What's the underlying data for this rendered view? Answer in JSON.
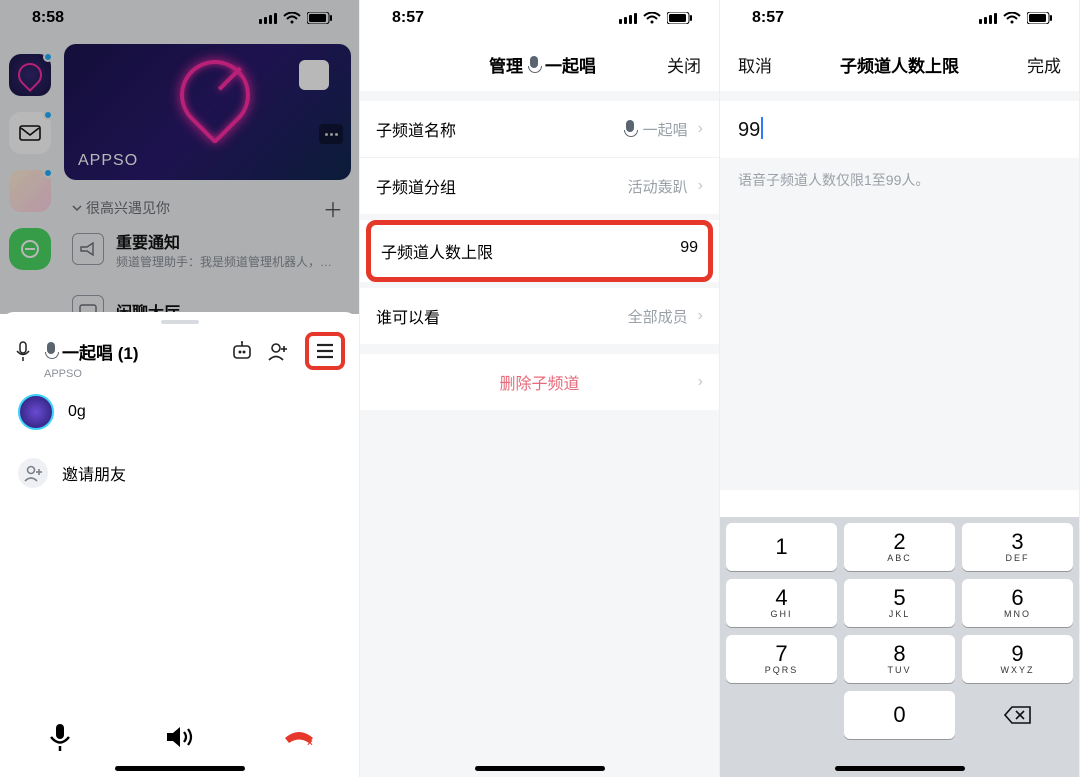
{
  "phone1": {
    "status_time": "8:58",
    "hero_label": "APPSO",
    "list_header": "很高兴遇见你",
    "item1_title": "重要通知",
    "item1_sub": "频道管理助手：我是频道管理机器人，…",
    "item2_title": "闲聊大厅",
    "sheet_title": "一起唱 (1)",
    "sheet_sub": "APPSO",
    "member_name": "0g",
    "invite_label": "邀请朋友"
  },
  "phone2": {
    "status_time": "8:57",
    "nav_prefix": "管理",
    "nav_suffix": "一起唱",
    "nav_close": "关闭",
    "row_name_label": "子频道名称",
    "row_name_value": "一起唱",
    "row_group_label": "子频道分组",
    "row_group_value": "活动轰趴",
    "row_limit_label": "子频道人数上限",
    "row_limit_value": "99",
    "row_who_label": "谁可以看",
    "row_who_value": "全部成员",
    "delete_label": "删除子频道"
  },
  "phone3": {
    "status_time": "8:57",
    "nav_cancel": "取消",
    "nav_title": "子频道人数上限",
    "nav_done": "完成",
    "input_value": "99",
    "hint": "语音子频道人数仅限1至99人。",
    "keypad": {
      "1": {
        "n": "1",
        "l": ""
      },
      "2": {
        "n": "2",
        "l": "ABC"
      },
      "3": {
        "n": "3",
        "l": "DEF"
      },
      "4": {
        "n": "4",
        "l": "GHI"
      },
      "5": {
        "n": "5",
        "l": "JKL"
      },
      "6": {
        "n": "6",
        "l": "MNO"
      },
      "7": {
        "n": "7",
        "l": "PQRS"
      },
      "8": {
        "n": "8",
        "l": "TUV"
      },
      "9": {
        "n": "9",
        "l": "WXYZ"
      },
      "0": {
        "n": "0",
        "l": ""
      }
    }
  }
}
